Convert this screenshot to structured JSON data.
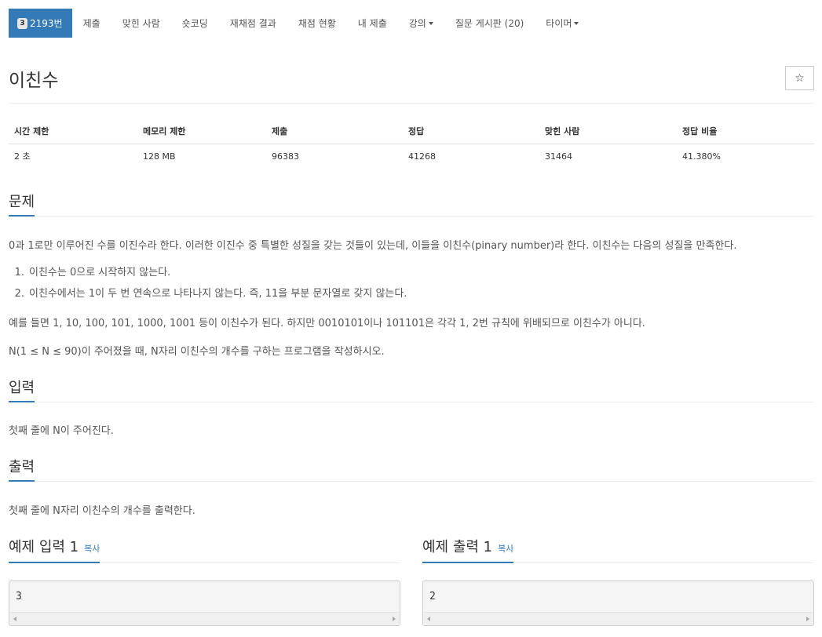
{
  "nav": {
    "problem_tier": "3",
    "problem_id": "2193번",
    "items": [
      "제출",
      "맞힌 사람",
      "숏코딩",
      "재채점 결과",
      "채점 현황",
      "내 제출",
      "강의",
      "질문 게시판 (20)",
      "타이머"
    ],
    "dropdown_items": [
      "강의",
      "타이머"
    ]
  },
  "title": "이친수",
  "star_icon": "☆",
  "stats": {
    "headers": [
      "시간 제한",
      "메모리 제한",
      "제출",
      "정답",
      "맞힌 사람",
      "정답 비율"
    ],
    "values": [
      "2 초",
      "128 MB",
      "96383",
      "41268",
      "31464",
      "41.380%"
    ]
  },
  "sections": {
    "problem": {
      "heading": "문제",
      "intro": "0과 1로만 이루어진 수를 이진수라 한다. 이러한 이진수 중 특별한 성질을 갖는 것들이 있는데, 이들을 이친수(pinary number)라 한다. 이친수는 다음의 성질을 만족한다.",
      "rules": [
        "이친수는 0으로 시작하지 않는다.",
        "이친수에서는 1이 두 번 연속으로 나타나지 않는다. 즉, 11을 부분 문자열로 갖지 않는다."
      ],
      "example": "예를 들면 1, 10, 100, 101, 1000, 1001 등이 이친수가 된다. 하지만 0010101이나 101101은 각각 1, 2번 규칙에 위배되므로 이친수가 아니다.",
      "task": "N(1 ≤ N ≤ 90)이 주어졌을 때, N자리 이친수의 개수를 구하는 프로그램을 작성하시오."
    },
    "input": {
      "heading": "입력",
      "text": "첫째 줄에 N이 주어진다."
    },
    "output": {
      "heading": "출력",
      "text": "첫째 줄에 N자리 이친수의 개수를 출력한다."
    }
  },
  "samples": {
    "input": {
      "heading": "예제 입력 1",
      "copy_label": "복사",
      "value": "3"
    },
    "output": {
      "heading": "예제 출력 1",
      "copy_label": "복사",
      "value": "2"
    }
  },
  "colors": {
    "accent": "#337ab7",
    "text": "#333333",
    "muted": "#555555"
  }
}
